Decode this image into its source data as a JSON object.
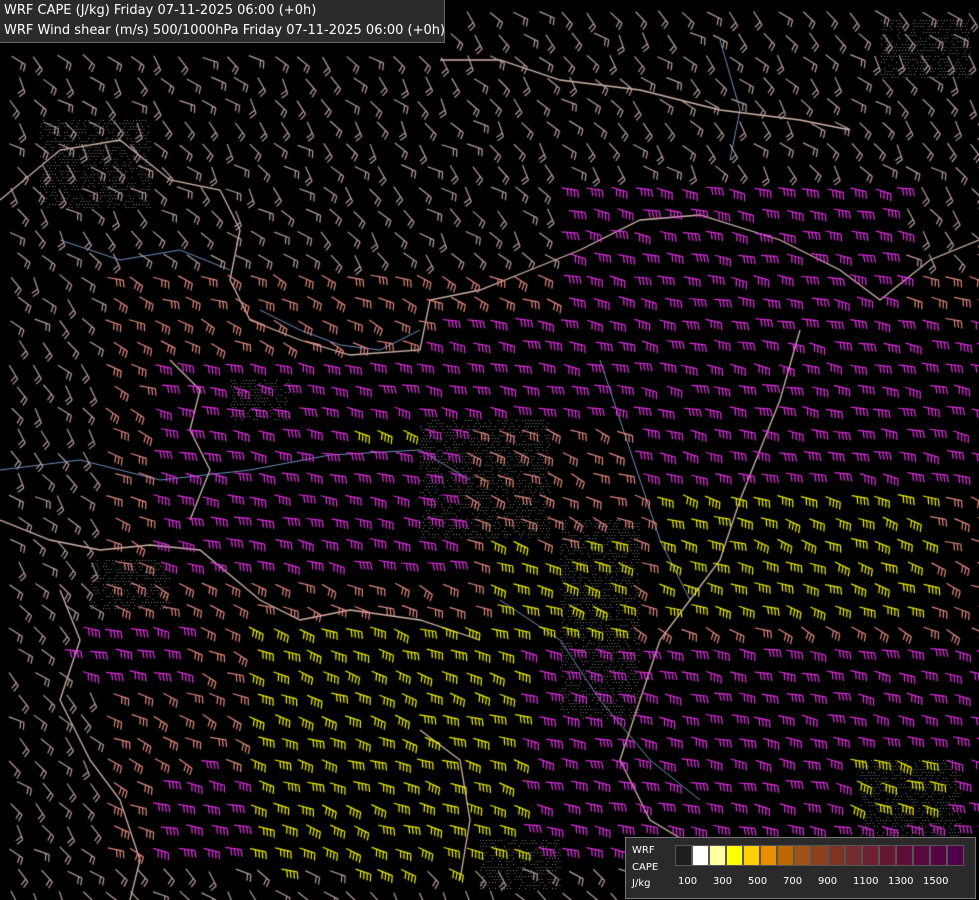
{
  "header": {
    "line1": "WRF CAPE (J/kg) Friday 07-11-2025 06:00 (+0h)",
    "line2": "WRF Wind shear (m/s) 500/1000hPa Friday 07-11-2025 06:00 (+0h)"
  },
  "legend": {
    "label1": "WRF",
    "label2": "CAPE",
    "label3": "J/kg",
    "colors": [
      "#1e1e1e",
      "#ffffff",
      "#ffffa0",
      "#ffff00",
      "#ffd000",
      "#e89000",
      "#c06800",
      "#a05218",
      "#8c4020",
      "#7c3424",
      "#742c2c",
      "#6c2030",
      "#641834",
      "#5c1038",
      "#58083c",
      "#540440",
      "#500048"
    ],
    "ticks": [
      "100",
      "300",
      "500",
      "700",
      "900",
      "1100",
      "1300",
      "1500"
    ]
  },
  "map": {
    "field_colors": {
      "background": "#000000",
      "weak_shear": "#b99ea0",
      "moderate_shear": "#e08a80",
      "strong_shear": "#e030e0",
      "cape_region": "#f0f000",
      "border_line": "#d2b7aa",
      "river_line": "#6f8fbf",
      "hatch": "#8a8a8a"
    }
  }
}
